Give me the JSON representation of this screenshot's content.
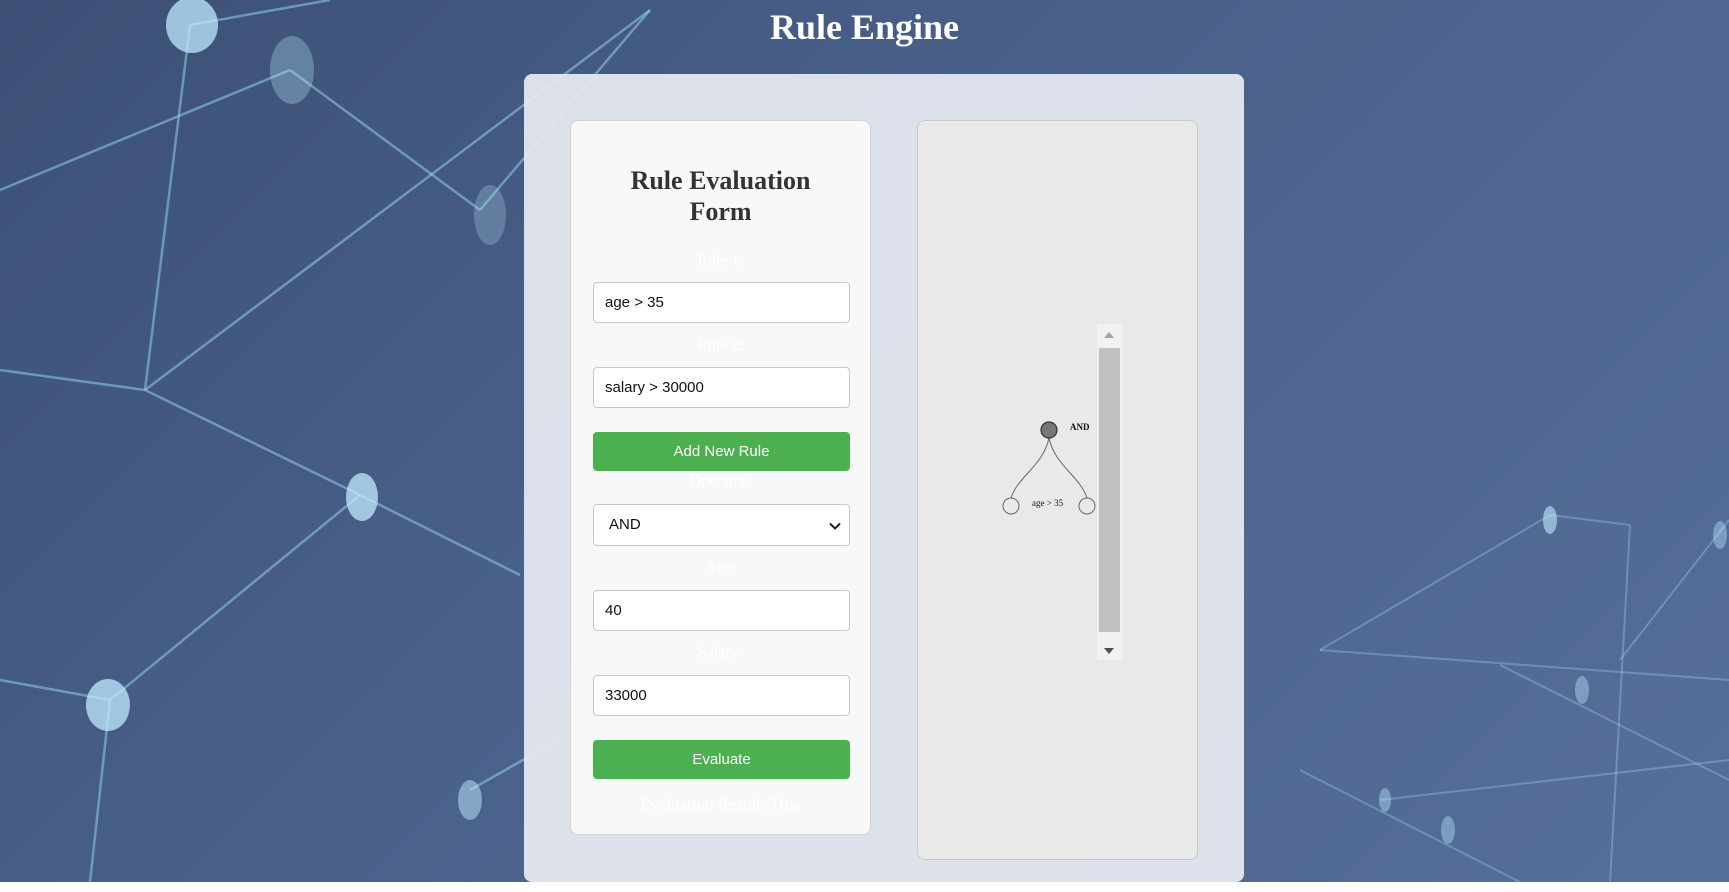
{
  "header": {
    "title": "Rule Engine"
  },
  "form": {
    "title_line1": "Rule Evaluation",
    "title_line2": "Form",
    "rule1_label": "Rule 1:",
    "rule1_value": "age > 35",
    "rule2_label": "Rule 2:",
    "rule2_value": "salary > 30000",
    "add_rule_label": "Add New Rule",
    "operator_label": "Operator:",
    "operator_value": "AND",
    "age_label": "Age:",
    "age_value": "40",
    "salary_label": "Salary:",
    "salary_value": "33000",
    "evaluate_label": "Evaluate",
    "result_text": "Evaluation Result: True"
  },
  "tree": {
    "root_label": "AND",
    "child_label": "age > 35"
  },
  "icons": {
    "select_arrow": "chevron-down-icon",
    "scroll_up": "scroll-up-arrow",
    "scroll_down": "scroll-down-arrow"
  },
  "colors": {
    "accent_green": "#4caf50",
    "background_blue": "#4a618a",
    "panel": "#e8ecf2"
  }
}
